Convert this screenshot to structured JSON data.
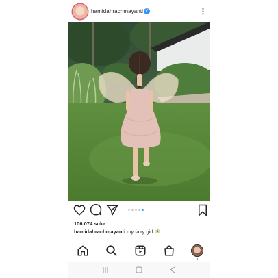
{
  "post": {
    "username": "hamidahrachmayanti",
    "likes": "106.074 suka",
    "caption_user": "hamidahrachmayanti",
    "caption_text": "my fairy girl 🧚"
  },
  "carousel": {
    "count": 5,
    "active": 4
  },
  "colors": {
    "accent": "#3897f0",
    "text": "#262626",
    "story_ring": "#e25c7b"
  },
  "icons": {
    "header": [
      "avatar",
      "verified-badge-icon",
      "more-options-icon"
    ],
    "actions": [
      "heart-icon",
      "comment-icon",
      "share-icon",
      "bookmark-icon"
    ],
    "nav": [
      "home-icon",
      "search-icon",
      "reels-icon",
      "shop-icon",
      "profile-avatar"
    ],
    "system": [
      "recents-icon",
      "home-circle-icon",
      "back-icon"
    ]
  }
}
